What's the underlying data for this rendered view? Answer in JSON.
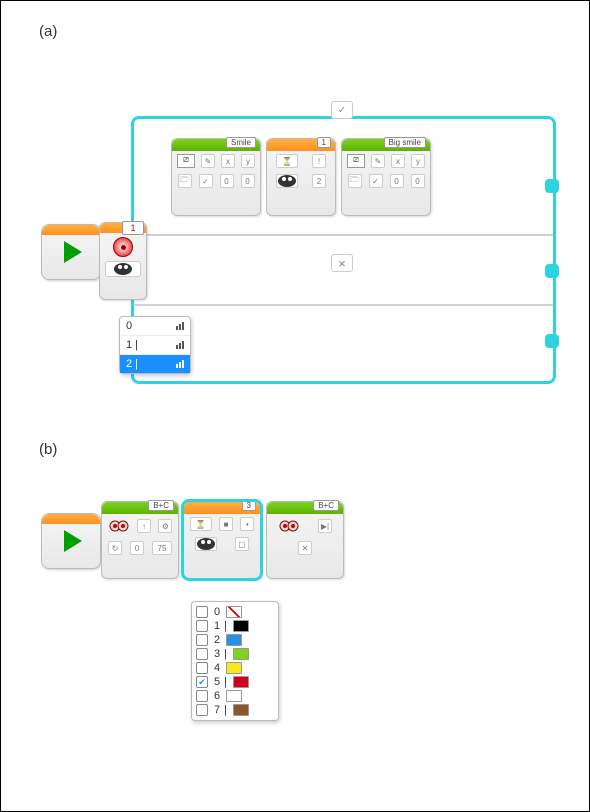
{
  "labels": {
    "a": "(a)",
    "b": "(b)"
  },
  "panel_a": {
    "start": {},
    "touch_sensor": {
      "port": "1",
      "mode_icon": "touch-sensor-icon",
      "dropdown": {
        "options": [
          {
            "value": "0",
            "label": "0",
            "selected": false
          },
          {
            "value": "1",
            "label": "1 |",
            "selected": false
          },
          {
            "value": "2",
            "label": "2 |",
            "selected": true
          }
        ]
      }
    },
    "switch": {
      "true_tab": "✓",
      "false_tab": "×",
      "true_branch": [
        {
          "type": "display",
          "title": "Smile",
          "params": [
            "✎",
            "x",
            "y"
          ],
          "row2": [
            "🗁",
            "✓",
            "0",
            "0"
          ]
        },
        {
          "type": "wait",
          "title": "1",
          "icon": "hourglass-icon",
          "params": [
            "!"
          ],
          "row2": [
            "👁",
            "2"
          ]
        },
        {
          "type": "display",
          "title": "Big smile",
          "params": [
            "✎",
            "x",
            "y"
          ],
          "row2": [
            "🗁",
            "✓",
            "0",
            "0"
          ]
        }
      ]
    }
  },
  "panel_b": {
    "start": {},
    "blocks": [
      {
        "type": "move",
        "title": "B+C",
        "icon": "motor-icon",
        "row1": [
          "↑",
          "⚙"
        ],
        "row2": [
          "↻",
          "0",
          "75"
        ]
      },
      {
        "type": "wait",
        "title": "3",
        "icon": "hourglass-icon",
        "row1": [
          "■",
          "•"
        ],
        "row2": [
          "👁",
          "▢"
        ],
        "selected": true
      },
      {
        "type": "move",
        "title": "B+C",
        "icon": "motor-icon",
        "row1": [
          "▶|"
        ],
        "row2": [
          "✕"
        ]
      }
    ],
    "color_dropdown": {
      "options": [
        {
          "idx": "0",
          "color": "none",
          "hex": "#ffffff",
          "checked": false
        },
        {
          "idx": "1",
          "color": "black",
          "hex": "#000000",
          "checked": false
        },
        {
          "idx": "2",
          "color": "blue",
          "hex": "#2a8fe6",
          "checked": false
        },
        {
          "idx": "3",
          "color": "green",
          "hex": "#7ed321",
          "checked": false
        },
        {
          "idx": "4",
          "color": "yellow",
          "hex": "#f8e71c",
          "checked": false
        },
        {
          "idx": "5",
          "color": "red",
          "hex": "#d0021b",
          "checked": true
        },
        {
          "idx": "6",
          "color": "white",
          "hex": "#ffffff",
          "checked": false
        },
        {
          "idx": "7",
          "color": "brown",
          "hex": "#8b572a",
          "checked": false
        }
      ]
    }
  }
}
